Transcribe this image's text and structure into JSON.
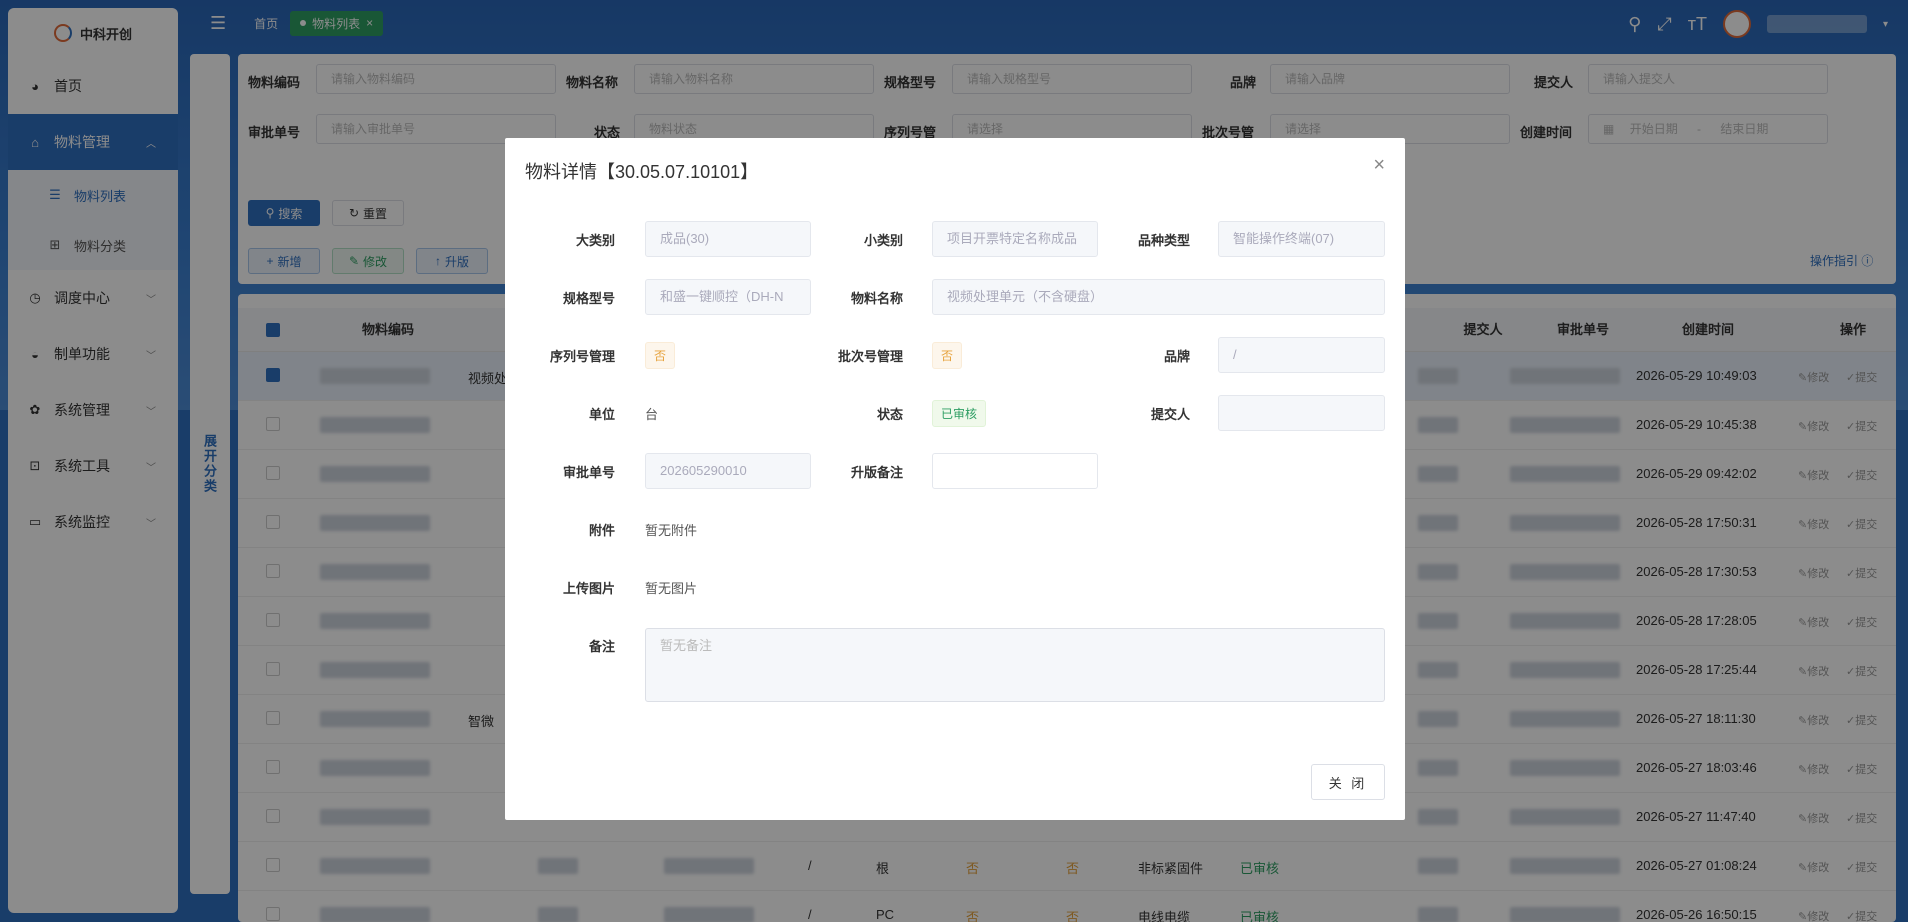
{
  "app": {
    "logo_text": "中科开创"
  },
  "sidebar": {
    "items": [
      {
        "label": "首页",
        "icon": "dashboard-icon"
      },
      {
        "label": "物料管理",
        "icon": "home-icon"
      },
      {
        "label": "调度中心",
        "icon": "clock-icon"
      },
      {
        "label": "制单功能",
        "icon": "gauge-icon"
      },
      {
        "label": "系统管理",
        "icon": "gear-icon"
      },
      {
        "label": "系统工具",
        "icon": "toolbox-icon"
      },
      {
        "label": "系统监控",
        "icon": "monitor-icon"
      }
    ],
    "sub_items": [
      {
        "label": "物料列表",
        "icon": "list-icon"
      },
      {
        "label": "物料分类",
        "icon": "tree-icon"
      }
    ]
  },
  "topbar": {
    "crumb": "首页",
    "active_tab": "物料列表",
    "close_glyph": "×"
  },
  "side_panel": {
    "expand_label": "展开分类"
  },
  "filters": {
    "row1": [
      {
        "label": "物料编码",
        "placeholder": "请输入物料编码"
      },
      {
        "label": "物料名称",
        "placeholder": "请输入物料名称"
      },
      {
        "label": "规格型号",
        "placeholder": "请输入规格型号"
      },
      {
        "label": "品牌",
        "placeholder": "请输入品牌"
      },
      {
        "label": "提交人",
        "placeholder": "请输入提交人"
      }
    ],
    "row2": [
      {
        "label": "审批单号",
        "placeholder": "请输入审批单号"
      },
      {
        "label": "状态",
        "placeholder": "物料状态"
      },
      {
        "label": "序列号管",
        "placeholder": "请选择"
      },
      {
        "label": "批次号管",
        "placeholder": "请选择"
      },
      {
        "label": "创建时间",
        "start": "开始日期",
        "sep": "-",
        "end": "结束日期"
      }
    ],
    "search_btn": "搜索",
    "reset_btn": "重置",
    "add_btn": "新增",
    "edit_btn": "修改",
    "upgrade_btn": "升版",
    "help_link": "操作指引"
  },
  "table": {
    "headers": {
      "code": "物料编码",
      "submitter": "提交人",
      "approval": "审批单号",
      "created": "创建时间",
      "ops": "操作"
    },
    "rows": [
      {
        "time": "2026-05-29 10:49:03",
        "name": "视频处"
      },
      {
        "time": "2026-05-29 10:45:38",
        "name": ""
      },
      {
        "time": "2026-05-29 09:42:02",
        "name": ""
      },
      {
        "time": "2026-05-28 17:50:31",
        "name": ""
      },
      {
        "time": "2026-05-28 17:30:53",
        "name": ""
      },
      {
        "time": "2026-05-28 17:28:05",
        "name": ""
      },
      {
        "time": "2026-05-28 17:25:44",
        "name": ""
      },
      {
        "time": "2026-05-27 18:11:30",
        "name": "智微"
      },
      {
        "time": "2026-05-27 18:03:46",
        "name": ""
      },
      {
        "time": "2026-05-27 11:47:40",
        "name": ""
      },
      {
        "time": "2026-05-27 01:08:24",
        "name": "",
        "slash": "/",
        "unit": "根",
        "sn": "否",
        "batch": "否",
        "category": "非标紧固件",
        "status": "已审核"
      },
      {
        "time": "2026-05-26 16:50:15",
        "name": "",
        "slash": "/",
        "unit": "PC",
        "sn": "否",
        "batch": "否",
        "category": "电线电缆",
        "status": "已审核"
      }
    ],
    "op_edit": "修改",
    "op_submit": "提交"
  },
  "dialog": {
    "title": "物料详情【30.05.07.10101】",
    "close_glyph": "×",
    "fields": {
      "major_label": "大类别",
      "major_value": "成品(30)",
      "minor_label": "小类别",
      "minor_value": "项目开票特定名称成品",
      "variety_label": "品种类型",
      "variety_value": "智能操作终端(07)",
      "spec_label": "规格型号",
      "spec_value": "和盛一键顺控（DH-N",
      "name_label": "物料名称",
      "name_value": "视频处理单元（不含硬盘）",
      "sn_label": "序列号管理",
      "sn_value": "否",
      "batch_label": "批次号管理",
      "batch_value": "否",
      "brand_label": "品牌",
      "brand_value": "/",
      "unit_label": "单位",
      "unit_value": "台",
      "status_label": "状态",
      "status_value": "已审核",
      "submitter_label": "提交人",
      "submitter_value": "",
      "approval_label": "审批单号",
      "approval_value": "202605290010",
      "upgrade_label": "升版备注",
      "upgrade_value": "",
      "attach_label": "附件",
      "attach_value": "暂无附件",
      "image_label": "上传图片",
      "image_value": "暂无图片",
      "remark_label": "备注",
      "remark_value": "暂无备注"
    },
    "close_btn": "关 闭"
  }
}
